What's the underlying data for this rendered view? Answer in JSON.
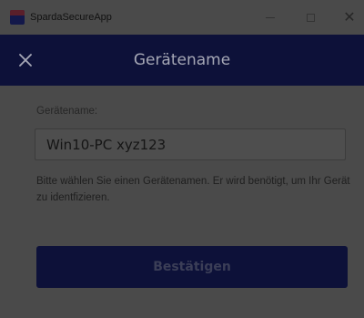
{
  "window": {
    "app_title": "SpardaSecureApp",
    "app_icon": "sparda-app-icon",
    "controls": {
      "minimize_icon": "minimize-icon",
      "maximize_icon": "maximize-icon",
      "close_icon": "close-icon",
      "close_glyph": "✕"
    }
  },
  "header": {
    "title": "Gerätename",
    "close_icon": "close-icon",
    "background_color": "#0d1139"
  },
  "form": {
    "label": "Gerätename:",
    "device_name_value": "Win10-PC xyz123",
    "help_text": "Bitte wählen Sie einen Gerätenamen. Er wird benötigt, um Ihr Gerät zu identfizieren.",
    "confirm_button_label": "Bestätigen"
  },
  "colors": {
    "overlay_dim": "#4a4a4a",
    "brand_navy": "#0d1139"
  }
}
